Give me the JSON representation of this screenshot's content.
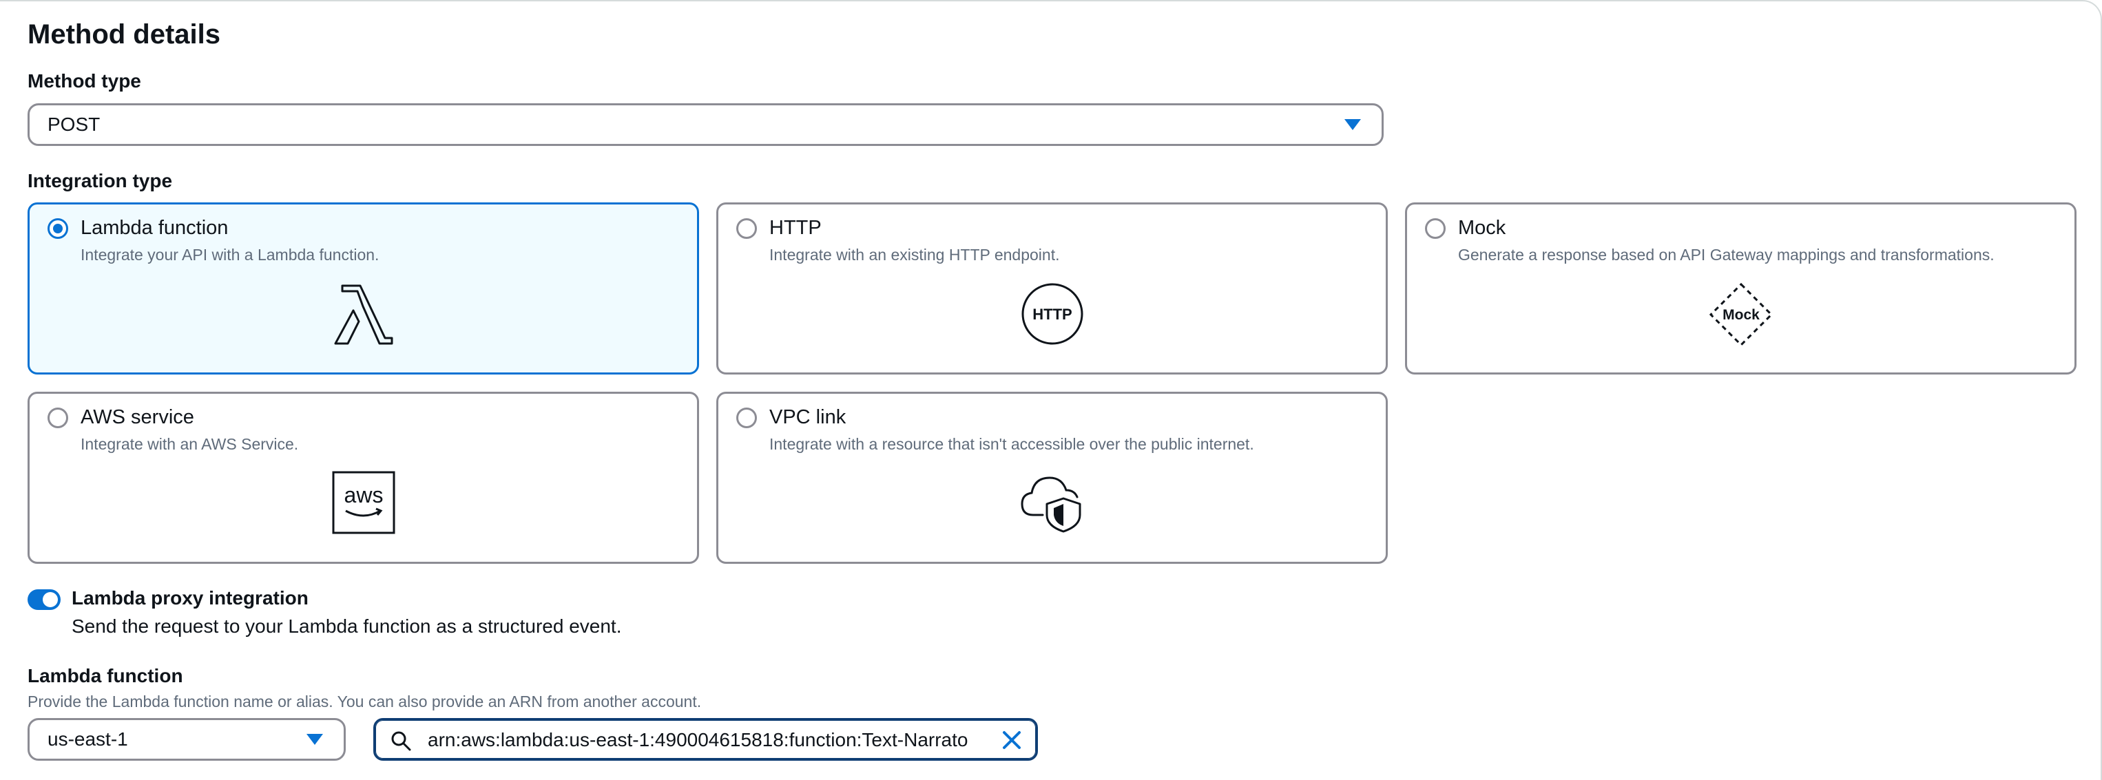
{
  "section_title": "Method details",
  "method_type": {
    "label": "Method type",
    "value": "POST"
  },
  "integration_type": {
    "label": "Integration type",
    "options": [
      {
        "title": "Lambda function",
        "description": "Integrate your API with a Lambda function.",
        "icon": "lambda-icon",
        "selected": true
      },
      {
        "title": "HTTP",
        "description": "Integrate with an existing HTTP endpoint.",
        "icon": "http-icon",
        "icon_text": "HTTP",
        "selected": false
      },
      {
        "title": "Mock",
        "description": "Generate a response based on API Gateway mappings and transformations.",
        "icon": "mock-icon",
        "icon_text": "Mock",
        "selected": false
      },
      {
        "title": "AWS service",
        "description": "Integrate with an AWS Service.",
        "icon": "aws-logo-icon",
        "icon_text": "aws",
        "selected": false
      },
      {
        "title": "VPC link",
        "description": "Integrate with a resource that isn't accessible over the public internet.",
        "icon": "cloud-shield-icon",
        "selected": false
      }
    ]
  },
  "proxy_integration": {
    "label": "Lambda proxy integration",
    "description": "Send the request to your Lambda function as a structured event.",
    "enabled": true
  },
  "lambda_function": {
    "label": "Lambda function",
    "description": "Provide the Lambda function name or alias. You can also provide an ARN from another account.",
    "region": "us-east-1",
    "arn_value": "arn:aws:lambda:us-east-1:490004615818:function:Text-Narrato"
  },
  "colors": {
    "accent": "#0972d3",
    "selected_bg": "#f0fbff",
    "border": "#8c8c94",
    "focus_border": "#0f3e74"
  }
}
